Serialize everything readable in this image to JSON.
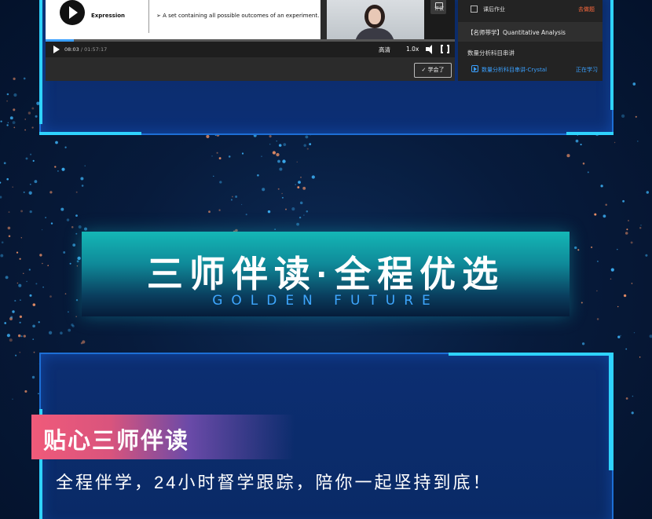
{
  "player": {
    "slide_term": "Expression",
    "slide_definition": "➢  A set containing all possible outcomes of an experiment.",
    "current_time": "08:03",
    "duration": "/ 01:57:17",
    "progress_fraction": 0.07,
    "quality": "高清",
    "speed": "1.0x",
    "comment_label": "评议",
    "learned_button": "✓ 学会了"
  },
  "course_panel": {
    "homework_label": "课后作业",
    "homework_action": "去做题",
    "course_title": "【名师带学】Quantitative Analysis",
    "section_title": "数量分析科目串讲",
    "lesson_title": "数量分析科目串讲-Crystal",
    "lesson_status": "正在学习"
  },
  "banner": {
    "title": "三师伴读·全程优选",
    "subtitle": "GOLDEN FUTURE"
  },
  "feature": {
    "tag": "贴心三师伴读",
    "slogan": "全程伴学，24小时督学跟踪，陪你一起坚持到底！"
  },
  "colors": {
    "background": "#061a3a",
    "frame_accent": "#2fd3ff",
    "banner_teal": "#14b7b6",
    "subtitle_blue": "#3fa7ff",
    "tag_pink": "#f05a7a",
    "link_blue": "#3aa0ff",
    "homework_action": "#ff6a3d"
  }
}
